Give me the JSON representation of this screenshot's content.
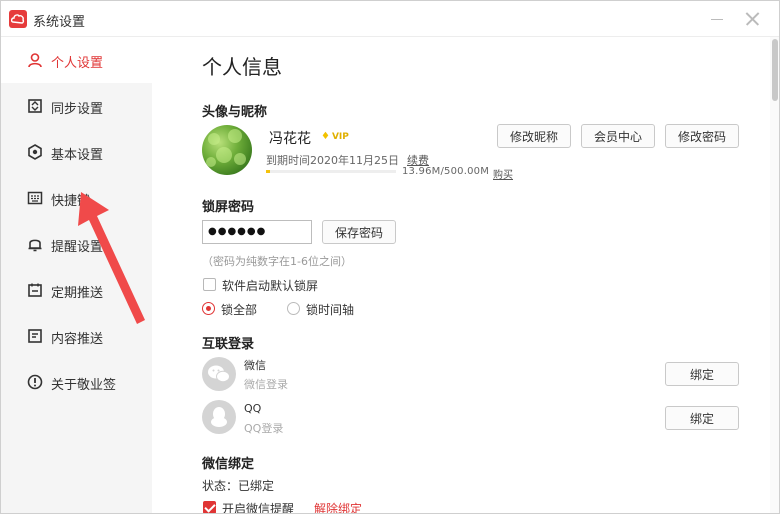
{
  "window": {
    "title": "系统设置"
  },
  "sidebar": {
    "items": [
      {
        "label": "个人设置",
        "icon": "person-icon",
        "active": true
      },
      {
        "label": "同步设置",
        "icon": "sync-icon",
        "active": false
      },
      {
        "label": "基本设置",
        "icon": "gear-icon",
        "active": false
      },
      {
        "label": "快捷键",
        "icon": "keyboard-icon",
        "active": false
      },
      {
        "label": "提醒设置",
        "icon": "bell-icon",
        "active": false
      },
      {
        "label": "定期推送",
        "icon": "calendar-icon",
        "active": false
      },
      {
        "label": "内容推送",
        "icon": "document-icon",
        "active": false
      },
      {
        "label": "关于敬业签",
        "icon": "info-icon",
        "active": false
      }
    ]
  },
  "main": {
    "page_title": "个人信息",
    "profile": {
      "section_title": "头像与昵称",
      "username": "冯花花",
      "vip": "VIP",
      "expire_text": "到期时间2020年11月25日",
      "renew_label": "续费",
      "storage_text": "13.96M/500.00M",
      "storage_used_fraction": 0.028,
      "buy_label": "购买",
      "buttons": {
        "edit_nickname": "修改昵称",
        "member_center": "会员中心",
        "change_password": "修改密码"
      }
    },
    "lock": {
      "section_title": "锁屏密码",
      "password_value": "●●●●●●",
      "save_label": "保存密码",
      "hint": "（密码为纯数字在1-6位之间）",
      "auto_lock_label": "软件启动默认锁屏",
      "auto_lock_checked": false,
      "lock_all_label": "锁全部",
      "lock_timeline_label": "锁时间轴",
      "selected": "lock_all"
    },
    "social": {
      "section_title": "互联登录",
      "items": [
        {
          "name": "微信",
          "sub": "微信登录",
          "bind_label": "绑定",
          "icon": "wechat-icon"
        },
        {
          "name": "QQ",
          "sub": "QQ登录",
          "bind_label": "绑定",
          "icon": "qq-icon"
        }
      ]
    },
    "wechat_bind": {
      "section_title": "微信绑定",
      "status": "状态：已绑定",
      "reminder_label": "开启微信提醒",
      "reminder_checked": true,
      "unbind_label": "解除绑定"
    }
  },
  "colors": {
    "accent": "#e03535",
    "vip_gold": "#f2c200",
    "sidebar_bg": "#f5f5f5"
  }
}
